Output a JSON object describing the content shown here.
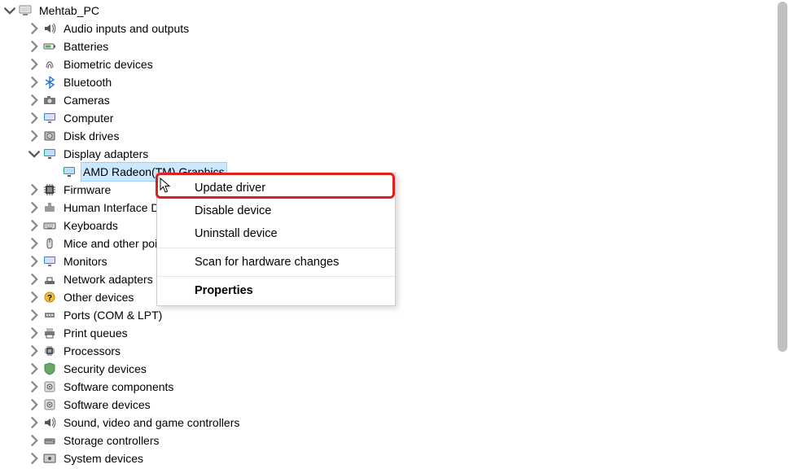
{
  "root": {
    "label": "Mehtab_PC"
  },
  "categories": [
    {
      "label": "Audio inputs and outputs",
      "icon": "speaker"
    },
    {
      "label": "Batteries",
      "icon": "battery"
    },
    {
      "label": "Biometric devices",
      "icon": "fingerprint"
    },
    {
      "label": "Bluetooth",
      "icon": "bluetooth"
    },
    {
      "label": "Cameras",
      "icon": "camera"
    },
    {
      "label": "Computer",
      "icon": "monitor"
    },
    {
      "label": "Disk drives",
      "icon": "disk"
    },
    {
      "label": "Display adapters",
      "icon": "display",
      "expanded": true,
      "children": [
        {
          "label": "AMD Radeon(TM) Graphics",
          "icon": "display",
          "selected": true
        }
      ]
    },
    {
      "label": "Firmware",
      "icon": "chip"
    },
    {
      "label": "Human Interface Devices",
      "icon": "hid"
    },
    {
      "label": "Keyboards",
      "icon": "keyboard"
    },
    {
      "label": "Mice and other pointing devices",
      "icon": "mouse"
    },
    {
      "label": "Monitors",
      "icon": "monitor"
    },
    {
      "label": "Network adapters",
      "icon": "network"
    },
    {
      "label": "Other devices",
      "icon": "other"
    },
    {
      "label": "Ports (COM & LPT)",
      "icon": "port"
    },
    {
      "label": "Print queues",
      "icon": "printer"
    },
    {
      "label": "Processors",
      "icon": "cpu"
    },
    {
      "label": "Security devices",
      "icon": "security"
    },
    {
      "label": "Software components",
      "icon": "software"
    },
    {
      "label": "Software devices",
      "icon": "software"
    },
    {
      "label": "Sound, video and game controllers",
      "icon": "speaker"
    },
    {
      "label": "Storage controllers",
      "icon": "storage"
    },
    {
      "label": "System devices",
      "icon": "system"
    }
  ],
  "context_menu": {
    "items": [
      {
        "label": "Update driver",
        "highlighted": true
      },
      {
        "label": "Disable device"
      },
      {
        "label": "Uninstall device"
      },
      {
        "sep": true
      },
      {
        "label": "Scan for hardware changes"
      },
      {
        "sep": true
      },
      {
        "label": "Properties",
        "bold": true
      }
    ]
  }
}
